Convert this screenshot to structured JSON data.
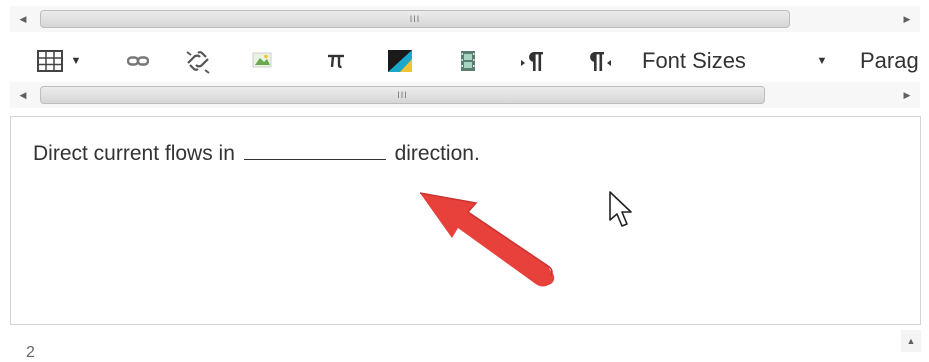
{
  "scrollbars": {
    "arrow_left": "◀",
    "arrow_right": "▶",
    "grip": "III",
    "arrow_up": "▲"
  },
  "toolbar": {
    "caret": "▼",
    "font_sizes_label": "Font Sizes",
    "paragraph_label": "Parag"
  },
  "editor": {
    "before_blank": "Direct current flows in",
    "after_blank": "direction."
  },
  "colors": {
    "arrow": "#e8403a",
    "text": "#333333",
    "image_icon": "#6aa84f",
    "media_icon": "#1aa9c9"
  },
  "icons": [
    "table-icon",
    "link-icon",
    "unlink-icon",
    "image-icon",
    "pi-icon",
    "media-icon",
    "filmstrip-icon",
    "ltr-pilcrow-icon",
    "rtl-pilcrow-icon"
  ]
}
